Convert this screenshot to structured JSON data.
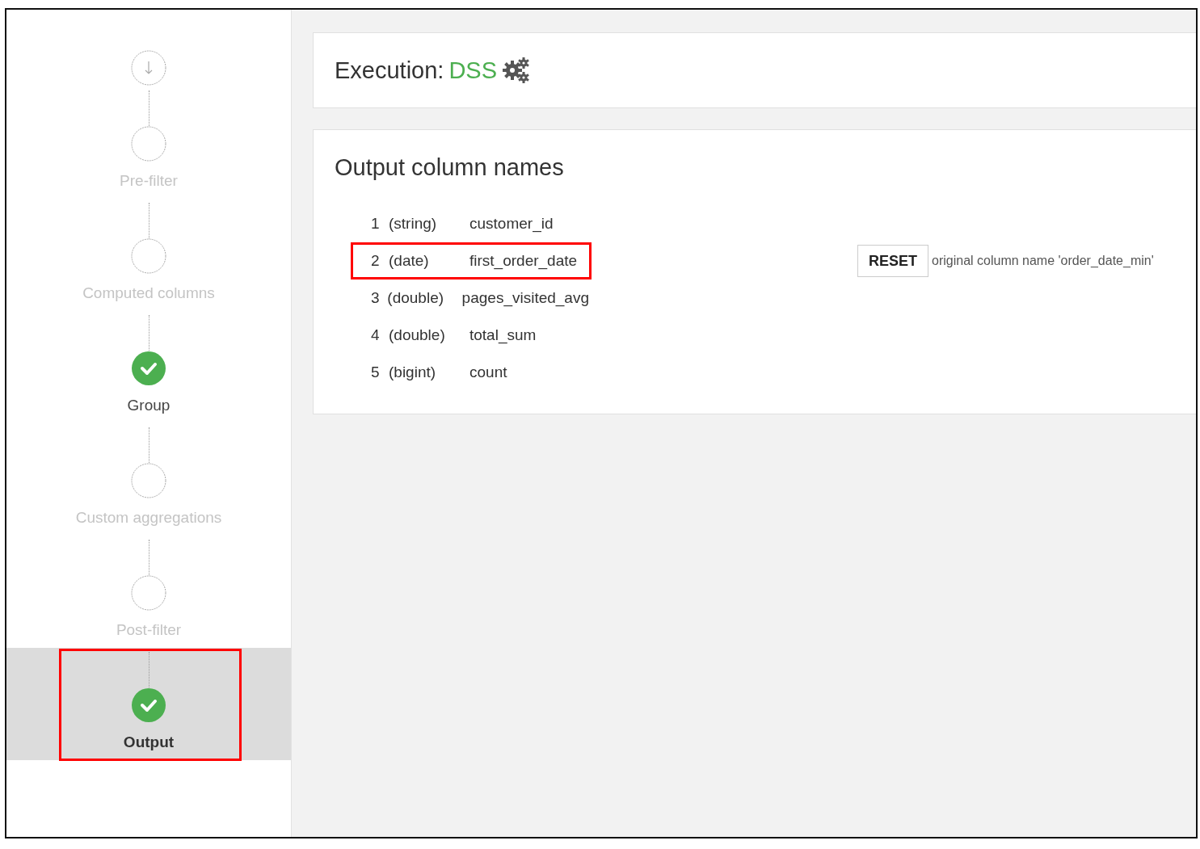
{
  "steps": [
    {
      "kind": "source"
    },
    {
      "kind": "step",
      "label": "Pre-filter",
      "done": false,
      "selected": false,
      "highlighted": false
    },
    {
      "kind": "step",
      "label": "Computed columns",
      "done": false,
      "selected": false,
      "highlighted": false
    },
    {
      "kind": "step",
      "label": "Group",
      "done": true,
      "selected": false,
      "highlighted": false
    },
    {
      "kind": "step",
      "label": "Custom aggregations",
      "done": false,
      "selected": false,
      "highlighted": false
    },
    {
      "kind": "step",
      "label": "Post-filter",
      "done": false,
      "selected": false,
      "highlighted": false
    },
    {
      "kind": "step",
      "label": "Output",
      "done": true,
      "selected": true,
      "highlighted": true
    }
  ],
  "execution": {
    "label": "Execution:",
    "engine": "DSS"
  },
  "output_columns": {
    "title": "Output column names",
    "rows": [
      {
        "index": "1",
        "type": "(string)",
        "name": "customer_id",
        "highlighted": false
      },
      {
        "index": "2",
        "type": "(date)",
        "name": "first_order_date",
        "highlighted": true,
        "reset_button": "RESET",
        "note": "original column name 'order_date_min'"
      },
      {
        "index": "3",
        "type": "(double)",
        "name": "pages_visited_avg",
        "highlighted": false
      },
      {
        "index": "4",
        "type": "(double)",
        "name": "total_sum",
        "highlighted": false
      },
      {
        "index": "5",
        "type": "(bigint)",
        "name": "count",
        "highlighted": false
      }
    ]
  }
}
